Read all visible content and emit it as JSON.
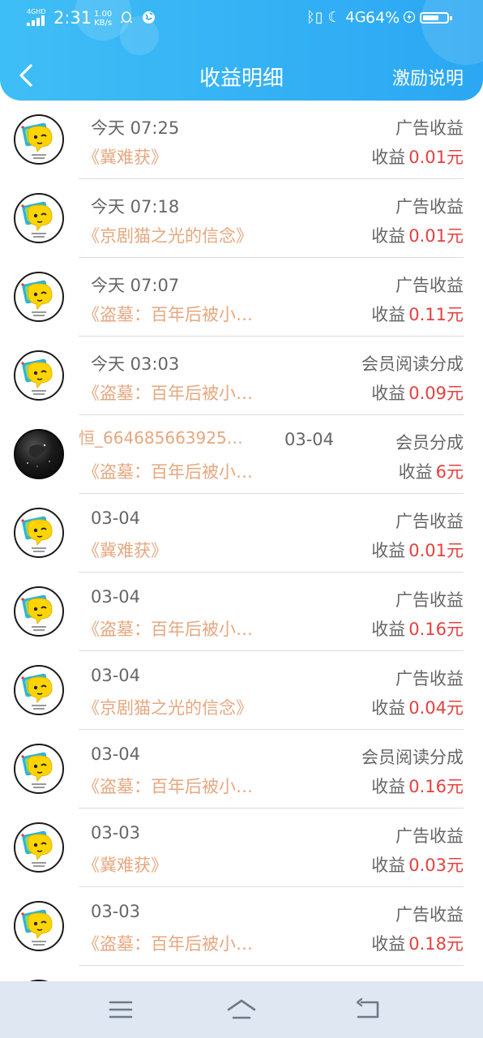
{
  "status_bar": {
    "network_label": "4GHD",
    "time": "2:31",
    "speed_value": "1.00",
    "speed_unit": "KB/s",
    "right_icons": "ᛒ▯ ☾ 4G",
    "battery_pct": "64%"
  },
  "header": {
    "title": "收益明细",
    "help_link": "激励说明"
  },
  "colors": {
    "header": "#2ba7f3",
    "book_title": "#e6a77f",
    "amount": "#e4403f"
  },
  "income_label": "收益",
  "records": [
    {
      "date": "今天 07:25",
      "source": "《冀难获》",
      "type": "广告收益",
      "amount": "0.01元",
      "avatar": "emoji"
    },
    {
      "date": "今天 07:18",
      "source": "《京剧猫之光的信念》",
      "type": "广告收益",
      "amount": "0.01元",
      "avatar": "emoji"
    },
    {
      "date": "今天 07:07",
      "source": "《盗墓：百年后被小…",
      "type": "广告收益",
      "amount": "0.11元",
      "avatar": "emoji"
    },
    {
      "date": "今天 03:03",
      "source": "《盗墓：百年后被小…",
      "type": "会员阅读分成",
      "amount": "0.09元",
      "avatar": "emoji"
    },
    {
      "user": "恒_664685663925…",
      "date": "03-04",
      "source": "《盗墓：百年后被小…",
      "type": "会员分成",
      "amount": "6元",
      "avatar": "dark"
    },
    {
      "date": "03-04",
      "source": "《冀难获》",
      "type": "广告收益",
      "amount": "0.01元",
      "avatar": "emoji"
    },
    {
      "date": "03-04",
      "source": "《盗墓：百年后被小…",
      "type": "广告收益",
      "amount": "0.16元",
      "avatar": "emoji"
    },
    {
      "date": "03-04",
      "source": "《京剧猫之光的信念》",
      "type": "广告收益",
      "amount": "0.04元",
      "avatar": "emoji"
    },
    {
      "date": "03-04",
      "source": "《盗墓：百年后被小…",
      "type": "会员阅读分成",
      "amount": "0.16元",
      "avatar": "emoji"
    },
    {
      "date": "03-03",
      "source": "《冀难获》",
      "type": "广告收益",
      "amount": "0.03元",
      "avatar": "emoji"
    },
    {
      "date": "03-03",
      "source": "《盗墓：百年后被小…",
      "type": "广告收益",
      "amount": "0.18元",
      "avatar": "emoji"
    },
    {
      "date": "",
      "source": "",
      "type": "",
      "amount": "",
      "avatar": "emoji"
    }
  ],
  "nav_bar": {
    "icons": [
      "menu-icon",
      "home-icon",
      "back-arrow-icon"
    ]
  }
}
